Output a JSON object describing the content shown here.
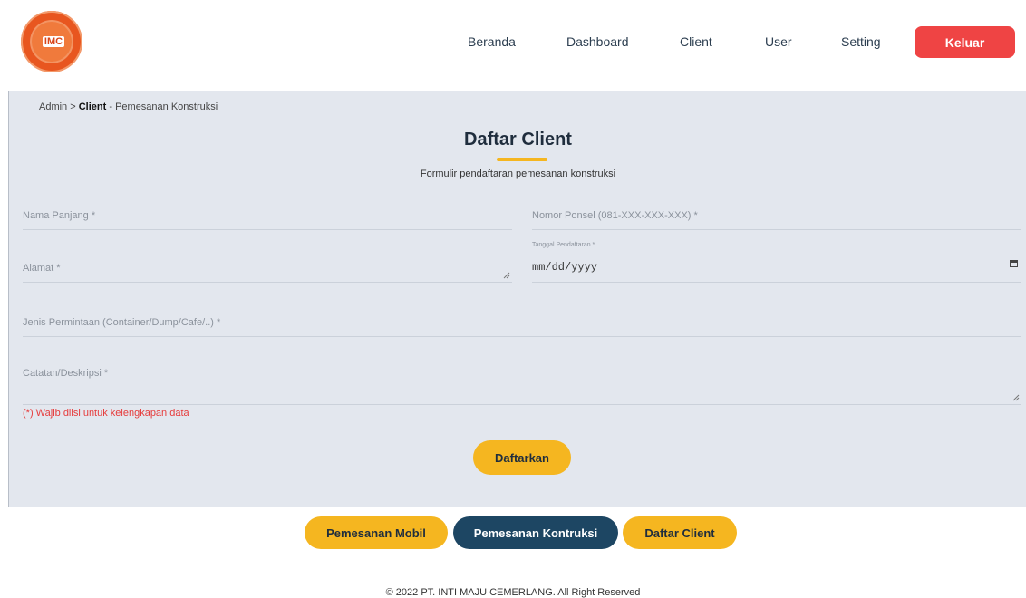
{
  "brand": {
    "logo_text": "IMC"
  },
  "nav": {
    "items": [
      "Beranda",
      "Dashboard",
      "Client",
      "User",
      "Setting"
    ],
    "logout": "Keluar"
  },
  "breadcrumb": {
    "admin": "Admin",
    "sep": " > ",
    "client": "Client",
    "page": " - Pemesanan Konstruksi"
  },
  "form": {
    "title": "Daftar Client",
    "subtitle": "Formulir pendaftaran pemesanan konstruksi",
    "full_name_label": "Nama Panjang *",
    "phone_label": "Nomor Ponsel (081-XXX-XXX-XXX) *",
    "address_label": "Alamat *",
    "reg_date_label": "Tanggal Pendaftaran *",
    "reg_date_value": "mm/dd/yyyy",
    "request_type_label": "Jenis Permintaan (Container/Dump/Cafe/..) *",
    "notes_label": "Catatan/Deskripsi *",
    "required_note": "(*) Wajib diisi untuk kelengkapan data",
    "submit_label": "Daftarkan"
  },
  "bottom_tabs": [
    "Pemesanan Mobil",
    "Pemesanan Kontruksi",
    "Daftar Client"
  ],
  "footer": "© 2022 PT. INTI MAJU CEMERLANG. All Right Reserved",
  "colors": {
    "accent": "#f5b620",
    "danger": "#ef4444",
    "active_tab": "#1d4663",
    "panel": "#e3e7ee"
  }
}
